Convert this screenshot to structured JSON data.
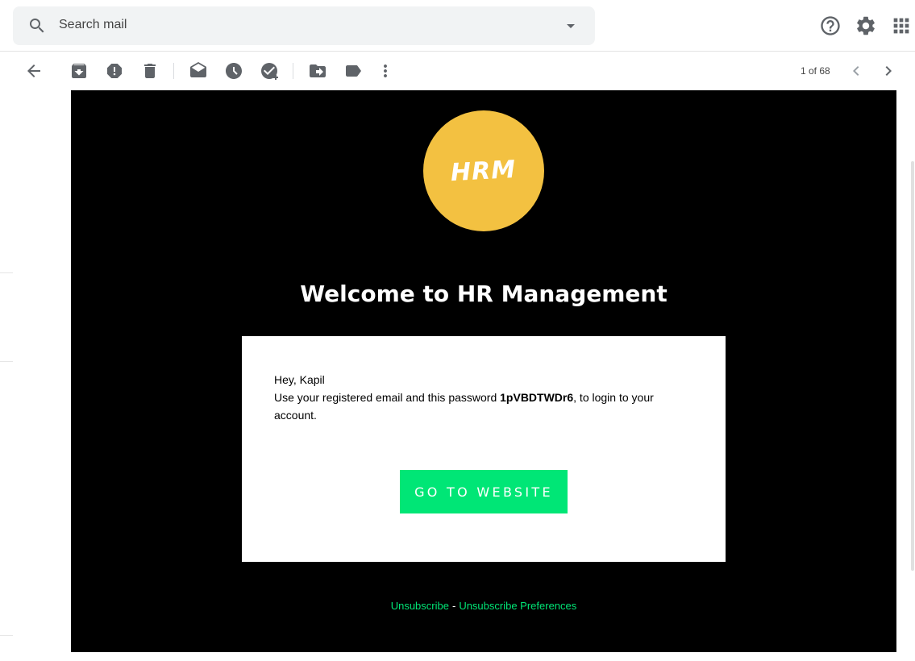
{
  "search": {
    "placeholder": "Search mail"
  },
  "icons": {
    "search": "search-icon",
    "dropdown": "arrow-drop-down-icon",
    "help": "help-icon",
    "settings": "gear-icon",
    "apps": "apps-grid-icon",
    "back": "arrow-back-icon",
    "archive": "archive-icon",
    "spam": "report-spam-icon",
    "delete": "trash-icon",
    "mark_unread": "mark-unread-icon",
    "snooze": "snooze-clock-icon",
    "add_task": "add-task-icon",
    "move_to": "move-to-icon",
    "labels": "label-icon",
    "more": "more-vert-icon",
    "prev": "chevron-left-icon",
    "next": "chevron-right-icon"
  },
  "pager": {
    "text": "1 of 68"
  },
  "email": {
    "logo_text": "HRM",
    "title": "Welcome to HR Management",
    "greeting": "Hey, Kapil",
    "message_before": "Use your registered email and this password ",
    "password": "1pVBDTWDr6",
    "message_after": ", to login to your account.",
    "button": "GO TO WEBSITE",
    "unsubscribe": "Unsubscribe",
    "separator": "-",
    "unsubscribe_prefs": "Unsubscribe Preferences"
  },
  "colors": {
    "logo": "#f3c141",
    "button": "#00e676",
    "links": "#00e676",
    "email_bg": "#000000"
  }
}
